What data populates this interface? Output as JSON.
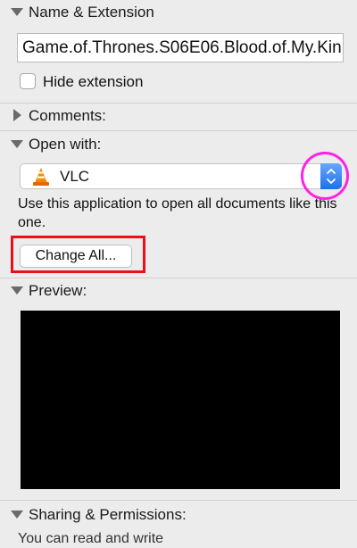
{
  "sections": {
    "name_extension": {
      "title": "Name & Extension"
    },
    "comments": {
      "title": "Comments:"
    },
    "open_with": {
      "title": "Open with:"
    },
    "preview": {
      "title": "Preview:"
    },
    "sharing": {
      "title": "Sharing & Permissions:"
    }
  },
  "name_field": {
    "value": "Game.of.Thrones.S06E06.Blood.of.My.Kin"
  },
  "hide_extension": {
    "label": "Hide extension",
    "checked": false
  },
  "open_with": {
    "app_name": "VLC",
    "app_icon": "vlc-cone-icon",
    "description": "Use this application to open all documents like this one.",
    "change_all_label": "Change All..."
  },
  "sharing": {
    "partial_text": "You can read and write"
  },
  "colors": {
    "background": "#ececec",
    "annotation_rect": "#e8101a",
    "annotation_circle": "#ff22e6",
    "stepper_blue": "#1f6fe8"
  }
}
